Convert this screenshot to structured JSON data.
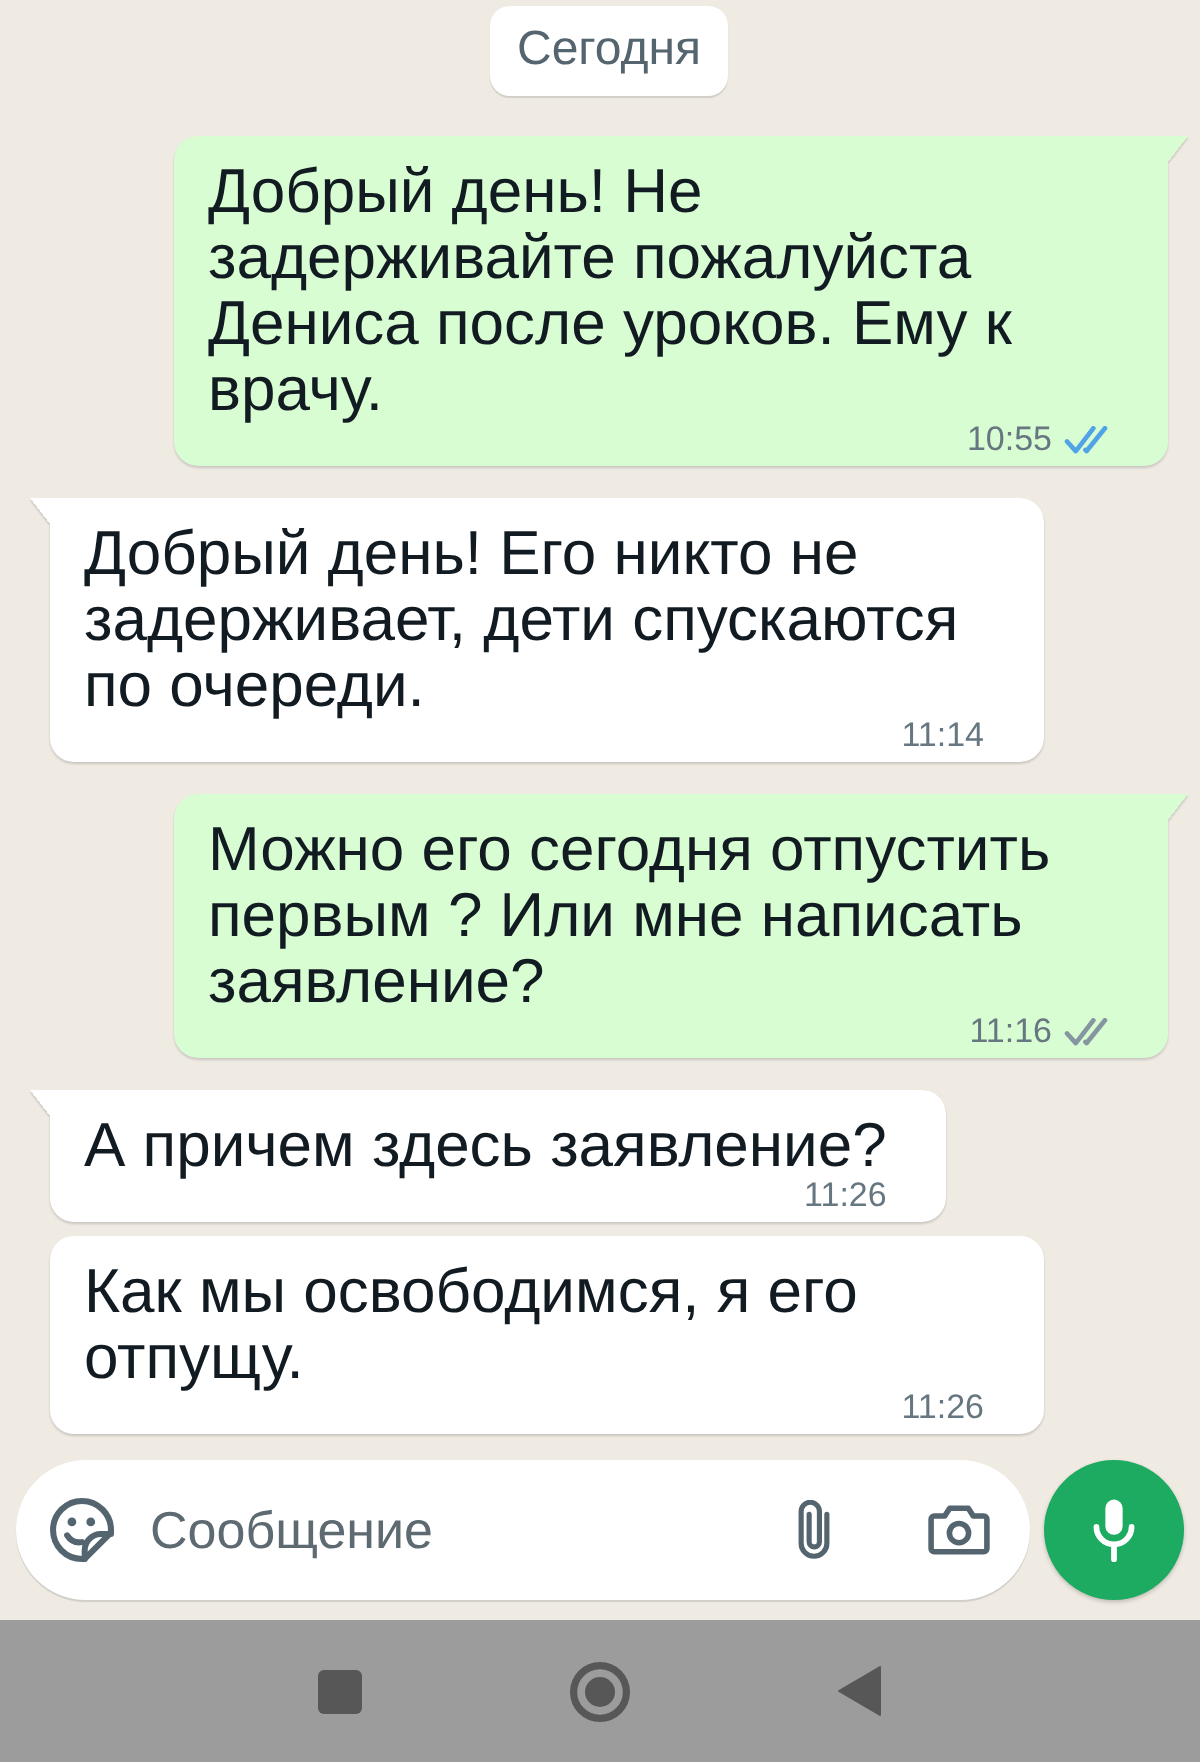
{
  "date_chip": "Сегодня",
  "messages": [
    {
      "kind": "outgoing",
      "text": "Добрый день! Не задерживайте пожалуйста Дениса после уроков. Ему к врачу.",
      "time": "10:55",
      "read": true
    },
    {
      "kind": "incoming",
      "text": "Добрый день! Его никто не задерживает, дети спускаются по очереди.",
      "time": "11:14"
    },
    {
      "kind": "outgoing",
      "text": "Можно его сегодня отпустить первым ? Или мне написать заявление?",
      "time": "11:16",
      "read": false
    },
    {
      "kind": "incoming",
      "text": "А причем здесь заявление?",
      "time": "11:26"
    },
    {
      "kind": "incoming",
      "text": "Как мы освободимся, я его отпущу.",
      "time": "11:26"
    }
  ],
  "composer": {
    "placeholder": "Сообщение"
  }
}
